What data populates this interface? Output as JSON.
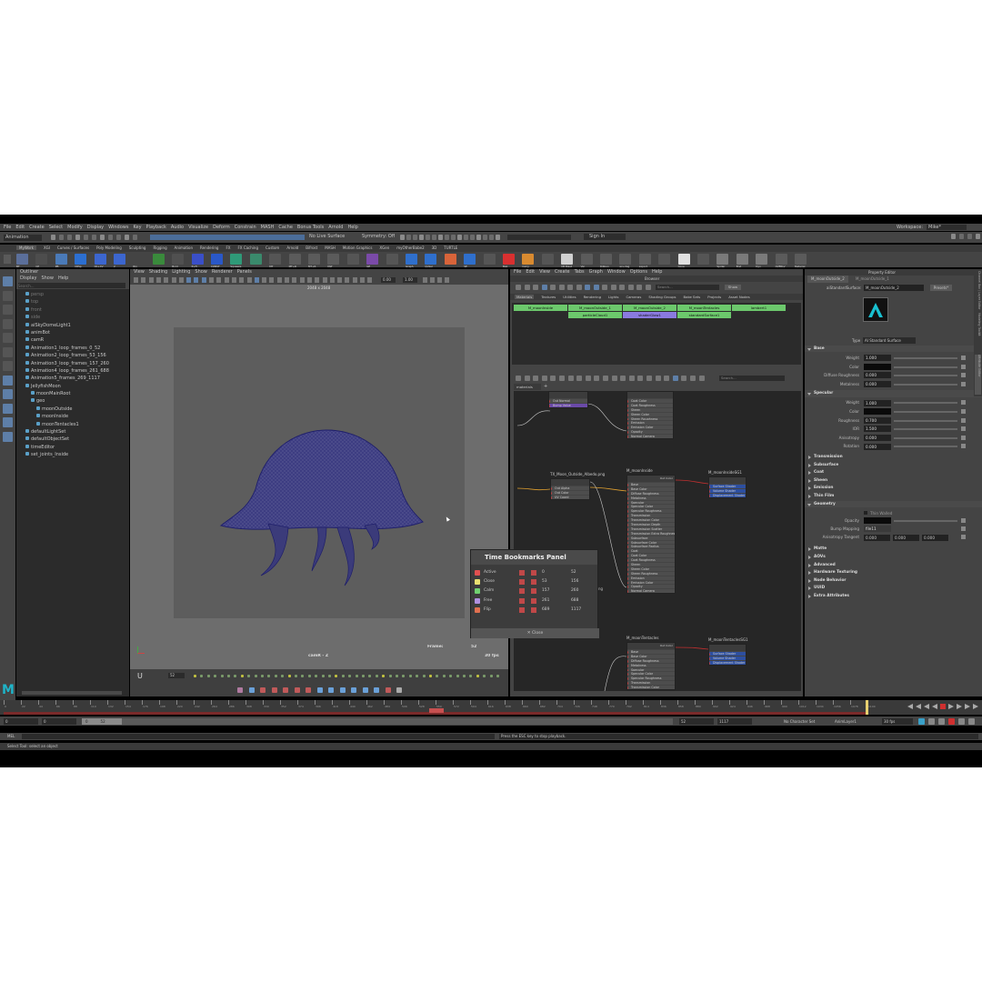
{
  "menubar": {
    "items": [
      "File",
      "Edit",
      "Create",
      "Select",
      "Modify",
      "Display",
      "Windows",
      "Key",
      "Playback",
      "Audio",
      "Visualize",
      "Deform",
      "Constrain",
      "MASH",
      "Cache",
      "Bonus Tools",
      "Arnold",
      "Help"
    ],
    "workspace_label": "Workspace:",
    "workspace_value": "Mike*"
  },
  "statusline": {
    "mode": "Animation",
    "live_surface": "No Live Surface",
    "symmetry": "Symmetry: Off",
    "sign_in": "Sign In"
  },
  "shelf": {
    "tabs": [
      "MyWork",
      "XGI",
      "Curves / Surfaces",
      "Poly Modeling",
      "Sculpting",
      "Rigging",
      "Animation",
      "Rendering",
      "FX",
      "FX Caching",
      "Custom",
      "Arnold",
      "Bifrost",
      "MASH",
      "Motion Graphics",
      "XGen",
      "myOtherBabe2",
      "3D",
      "TURTLE"
    ],
    "labels": [
      "BT",
      "CP",
      "PB",
      "CRSp",
      "CK+CV",
      "2",
      "Rlx",
      "",
      "Bvrd",
      "P+Fr",
      "CONST",
      "Squeeze",
      "",
      "MT",
      "MT+R",
      "MT+R",
      "MLT",
      "",
      "GE",
      "",
      "Graph",
      "QuSel",
      "",
      "SE",
      "",
      "Bak",
      "Carry",
      "",
      "CB Blast",
      "Var",
      "Ribbon",
      "ex+dag",
      "export",
      "",
      "Cone",
      "",
      "Spider",
      "Bnd",
      "Dyn",
      "OVERLV",
      "Material"
    ],
    "colors": [
      "#5b6f9a",
      "#4d4d4d",
      "#4a7ab8",
      "#2c6fd1",
      "#3c66cf",
      "#3c66cf",
      "#444",
      "#3a8a3c",
      "#505050",
      "#3a4fc8",
      "#2a58c8",
      "#2f9a78",
      "#3a8a6c",
      "#555",
      "#5b5b5b",
      "#5b5b5b",
      "#5b5b5b",
      "#555",
      "#7a4aa8",
      "#555",
      "#2f6fcc",
      "#2f6fcc",
      "#d8643a",
      "#2f6fcc",
      "#555",
      "#d83030",
      "#d88a30",
      "#555",
      "#d0d0d0",
      "#5b5b5b",
      "#5b5b5b",
      "#5b5b5b",
      "#5b5b5b",
      "#555",
      "#e0e0e0",
      "#555",
      "#7a7a7a",
      "#7a7a7a",
      "#7a7a7a",
      "#5b5b5b",
      "#5b5b5b"
    ]
  },
  "outliner": {
    "title": "Outliner",
    "menu": [
      "Display",
      "Show",
      "Help"
    ],
    "search_placeholder": "Search...",
    "items": [
      {
        "label": "persp",
        "indent": 0,
        "dim": true
      },
      {
        "label": "top",
        "indent": 0,
        "dim": true
      },
      {
        "label": "front",
        "indent": 0,
        "dim": true
      },
      {
        "label": "side",
        "indent": 0,
        "dim": true
      },
      {
        "label": "aiSkyDomeLight1",
        "indent": 0,
        "dim": false
      },
      {
        "label": "animBot",
        "indent": 0,
        "dim": false
      },
      {
        "label": "camR",
        "indent": 0,
        "dim": false
      },
      {
        "label": "Animation1_loop_frames_0_52",
        "indent": 0,
        "dim": false
      },
      {
        "label": "Animation2_loop_frames_53_156",
        "indent": 0,
        "dim": false
      },
      {
        "label": "Animation3_loop_frames_157_260",
        "indent": 0,
        "dim": false
      },
      {
        "label": "Animation4_loop_frames_261_688",
        "indent": 0,
        "dim": false
      },
      {
        "label": "Animation5_frames_269_1117",
        "indent": 0,
        "dim": false
      },
      {
        "label": "JellyfishMoon",
        "indent": 0,
        "dim": false
      },
      {
        "label": "moonMainRoot",
        "indent": 1,
        "dim": false
      },
      {
        "label": "geo",
        "indent": 1,
        "dim": false
      },
      {
        "label": "moonOutside",
        "indent": 2,
        "dim": false
      },
      {
        "label": "moonInside",
        "indent": 2,
        "dim": false
      },
      {
        "label": "moonTentacles1",
        "indent": 2,
        "dim": false
      },
      {
        "label": "defaultLightSet",
        "indent": 0,
        "dim": false
      },
      {
        "label": "defaultObjectSet",
        "indent": 0,
        "dim": false
      },
      {
        "label": "timeEditor",
        "indent": 0,
        "dim": false
      },
      {
        "label": "set_joints_Inside",
        "indent": 0,
        "dim": false
      }
    ]
  },
  "viewport": {
    "menu": [
      "View",
      "Shading",
      "Lighting",
      "Show",
      "Renderer",
      "Panels"
    ],
    "resolution": "2048 x 2048",
    "camera_name": "camR - Z",
    "frame_label": "Frame:",
    "frame_value": "52",
    "fps": "30 fps",
    "field1": "0.00",
    "field2": "1.00"
  },
  "hypershade": {
    "menu": [
      "File",
      "Edit",
      "View",
      "Create",
      "Tabs",
      "Graph",
      "Window",
      "Options",
      "Help"
    ],
    "title": "Browser",
    "tabs": [
      "Materials",
      "Textures",
      "Utilities",
      "Rendering",
      "Lights",
      "Cameras",
      "Shading Groups",
      "Bake Sets",
      "Projects",
      "Asset Nodes"
    ],
    "show_label": "Show",
    "search_placeholder": "Search...",
    "materials": [
      {
        "label": "M_moonInside",
        "color": "#6cc86c"
      },
      {
        "label": "M_moonOutside_1",
        "color": "#6cc86c"
      },
      {
        "label": "M_moonOutside_2",
        "color": "#6cc86c"
      },
      {
        "label": "M_moonTentacles",
        "color": "#6cc86c"
      },
      {
        "label": "lambert1",
        "color": "#6cc86c"
      },
      {
        "label": "particleCloud1",
        "color": "#6cc86c"
      },
      {
        "label": "shaderGlow1",
        "color": "#8a7adf"
      },
      {
        "label": "standardSurface1",
        "color": "#6cc86c"
      }
    ],
    "graph_tab": "materials",
    "nodes": {
      "bump": {
        "title": "bump2d1",
        "rows": [
          "Out Normal",
          "Bump Value"
        ]
      },
      "file": {
        "title": "TX_Moon_Outside_Albedo.png",
        "rows": [
          "Out Alpha",
          "Out Color",
          "UV Coord"
        ]
      },
      "top_rows": [
        "Coat Color",
        "Coat Roughness",
        "Sheen",
        "Sheen Color",
        "Sheen Roughness",
        "Emission",
        "Emission Color",
        "Opacity",
        "Normal Camera"
      ],
      "m_inside": {
        "title": "M_moonInside",
        "rows": [
          "Base",
          "Base Color",
          "Diffuse Roughness",
          "Metalness",
          "Specular",
          "Specular Color",
          "Specular Roughness",
          "Transmission",
          "Transmission Color",
          "Transmission Depth",
          "Transmission Scatter",
          "Transmission Extra Roughness",
          "Subsurface",
          "Subsurface Color",
          "Subsurface Radius",
          "Coat",
          "Coat Color",
          "Coat Roughness",
          "Sheen",
          "Sheen Color",
          "Sheen Roughness",
          "Emission",
          "Emission Color",
          "Opacity",
          "Normal Camera"
        ]
      },
      "sg_inside": {
        "title": "M_moonInsideSG1",
        "rows": [
          "Surface Shader",
          "Volume Shader",
          "Displacement Shader"
        ]
      },
      "m_tent": {
        "title": "M_moonTentacles",
        "rows": [
          "Base",
          "Base Color",
          "Diffuse Roughness",
          "Metalness",
          "Specular",
          "Specular Color",
          "Specular Roughness",
          "Transmission",
          "Transmission Color"
        ]
      },
      "sg_tent": {
        "title": "M_moonTentaclesSG1",
        "rows": [
          "Surface Shader",
          "Volume Shader",
          "Displacement Shader"
        ]
      },
      "out_color": "Out Color"
    }
  },
  "bookmarks": {
    "title": "Time Bookmarks Panel",
    "close_label": "Close",
    "rows": [
      {
        "name": "Active",
        "color": "#e05050",
        "start": "0",
        "end": "52"
      },
      {
        "name": "Close",
        "color": "#e8e070",
        "start": "53",
        "end": "156"
      },
      {
        "name": "Calm",
        "color": "#70d070",
        "start": "157",
        "end": "260"
      },
      {
        "name": "Free",
        "color": "#b090e0",
        "start": "261",
        "end": "688"
      },
      {
        "name": "Flip",
        "color": "#e07050",
        "start": "689",
        "end": "1117"
      }
    ],
    "node_side_label": "ng"
  },
  "attribute_editor": {
    "title": "Property Editor",
    "tab1": "M_moonOutside_2",
    "tab2": "M_moonOutside_1",
    "node_type": "aiStandardSurface:",
    "node_name": "M_moonOutside_2",
    "presets": "Presets*",
    "type_label": "Type",
    "type_value": "AI Standard Surface",
    "sections": {
      "base": "Base",
      "specular": "Specular",
      "transmission": "Transmission",
      "subsurface": "Subsurface",
      "coat": "Coat",
      "sheen": "Sheen",
      "emission": "Emission",
      "thin_film": "Thin Film",
      "geometry": "Geometry",
      "matte": "Matte",
      "aovs": "AOVs",
      "advanced": "Advanced",
      "hw": "Hardware Texturing",
      "node_behavior": "Node Behavior",
      "uuid": "UUID",
      "extra": "Extra Attributes"
    },
    "base": [
      {
        "label": "Weight",
        "value": "1.000"
      },
      {
        "label": "Color",
        "value": ""
      },
      {
        "label": "Diffuse Roughness",
        "value": "0.000"
      },
      {
        "label": "Metalness",
        "value": "0.000"
      }
    ],
    "specular": [
      {
        "label": "Weight",
        "value": "1.000"
      },
      {
        "label": "Color",
        "value": ""
      },
      {
        "label": "Roughness",
        "value": "0.700"
      },
      {
        "label": "IOR",
        "value": "1.500"
      },
      {
        "label": "Anisotropy",
        "value": "0.000"
      },
      {
        "label": "Rotation",
        "value": "0.000"
      }
    ],
    "thin_walled": "Thin Walled",
    "opacity_label": "Opacity",
    "bump_label": "Bump Mapping",
    "bump_value": "file11",
    "aniso_label": "Anisotropy Tangent",
    "aniso_values": [
      "0.000",
      "0.000",
      "0.000"
    ],
    "side_tabs": [
      "Channel Box / Layer Editor",
      "Modeling Toolkit",
      "Attribute Editor"
    ]
  },
  "timeline": {
    "ticks": [
      "0",
      "22",
      "44",
      "66",
      "88",
      "110",
      "132",
      "154",
      "176",
      "198",
      "220",
      "242",
      "264",
      "286",
      "308",
      "330",
      "352",
      "374",
      "396",
      "418",
      "440",
      "462",
      "484",
      "506",
      "528",
      "550",
      "572",
      "594",
      "616",
      "638",
      "660",
      "682",
      "704",
      "726",
      "748",
      "770",
      "792",
      "814",
      "836",
      "858",
      "880",
      "902",
      "924",
      "946",
      "968",
      "990",
      "1012",
      "1034",
      "1056",
      "1078",
      "1100"
    ],
    "current_frame": "52",
    "range_start": "0",
    "range_start2": "0",
    "range_inner_start": "0",
    "range_inner_end": "52",
    "range_end": "52",
    "range_end2": "1117",
    "no_char_set": "No Character Set",
    "anim_layer": "AnimLayer1",
    "fps": "30 fps",
    "playback_marker": "312"
  },
  "commandline": {
    "label": "MEL",
    "message": "Press the ESC key to stop playback.",
    "help": "Select Tool: select an object"
  }
}
